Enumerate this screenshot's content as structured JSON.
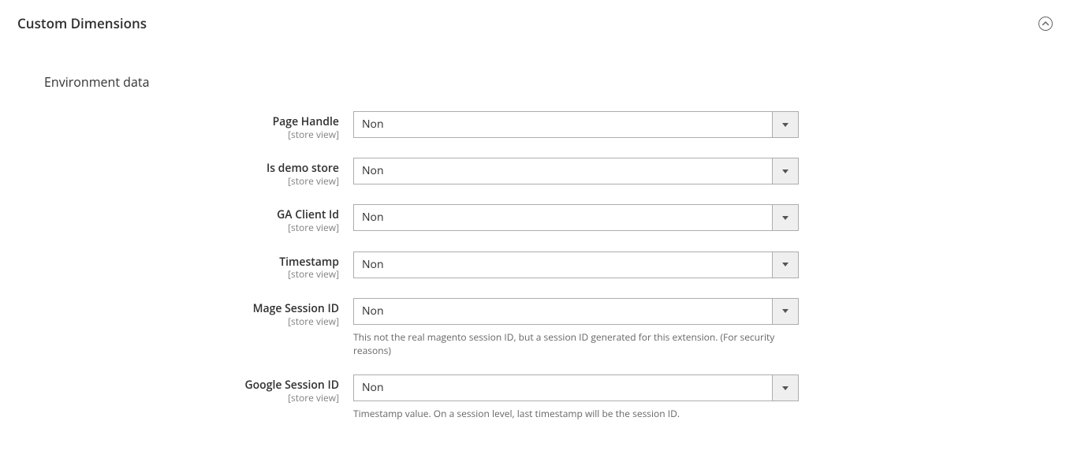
{
  "section": {
    "title": "Custom Dimensions"
  },
  "subsection": {
    "title": "Environment data"
  },
  "scope_label": "[store view]",
  "fields": {
    "page_handle": {
      "label": "Page Handle",
      "value": "Non"
    },
    "is_demo_store": {
      "label": "Is demo store",
      "value": "Non"
    },
    "ga_client_id": {
      "label": "GA Client Id",
      "value": "Non"
    },
    "timestamp": {
      "label": "Timestamp",
      "value": "Non"
    },
    "mage_session_id": {
      "label": "Mage Session ID",
      "value": "Non",
      "help": "This not the real magento session ID, but a session ID generated for this extension. (For security reasons)"
    },
    "google_session_id": {
      "label": "Google Session ID",
      "value": "Non",
      "help": "Timestamp value. On a session level, last timestamp will be the session ID."
    }
  }
}
